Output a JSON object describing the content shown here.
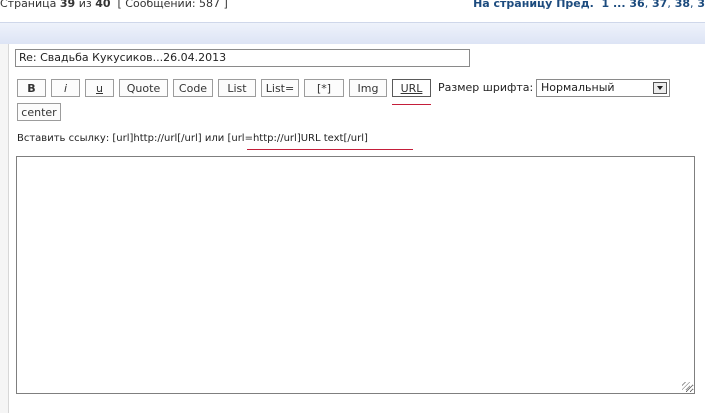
{
  "pagination": {
    "page_word": "Страница",
    "current": "39",
    "of_word": "из",
    "total": "40",
    "messages_label": "[ Сообщений: 587 ]",
    "goto_label": "На страницу",
    "prev_label": "Пред.",
    "pages": [
      "1",
      "...",
      "36",
      "37",
      "38",
      "3"
    ]
  },
  "subject": {
    "value": "Re: Свадьба Кукусиков...26.04.2013"
  },
  "toolbar": {
    "buttons": [
      "B",
      "i",
      "u",
      "Quote",
      "Code",
      "List",
      "List=",
      "[*]",
      "Img",
      "URL"
    ],
    "center_label": "center",
    "font_size_label": "Размер шрифта:",
    "font_size_value": "Нормальный"
  },
  "hint": {
    "text": "Вставить ссылку: [url]http://url[/url] или",
    "example": "[url=http://url]URL text[/url]"
  },
  "colors": {
    "accent_link": "#1c4b7e",
    "highlight_underline": "#c41e3a"
  }
}
